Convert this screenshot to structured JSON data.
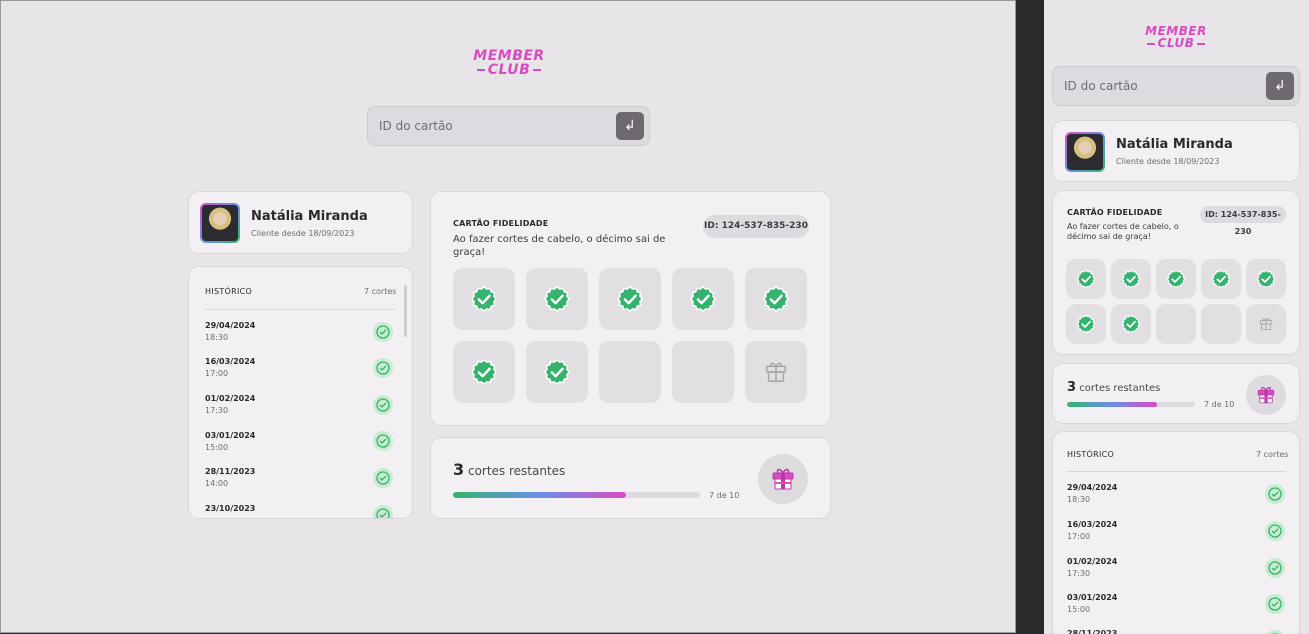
{
  "app": {
    "logo_line1": "MEMBER",
    "logo_line2": "CLUB"
  },
  "search": {
    "placeholder": "ID do cartão",
    "submit_icon": "enter-icon"
  },
  "user": {
    "name": "Natália Miranda",
    "since": "Cliente desde 18/09/2023"
  },
  "history": {
    "title": "HISTÓRICO",
    "count": "7 cortes",
    "items": [
      {
        "date": "29/04/2024",
        "time": "18:30"
      },
      {
        "date": "16/03/2024",
        "time": "17:00"
      },
      {
        "date": "01/02/2024",
        "time": "17:30"
      },
      {
        "date": "03/01/2024",
        "time": "15:00"
      },
      {
        "date": "28/11/2023",
        "time": "14:00"
      },
      {
        "date": "23/10/2023",
        "time": ""
      }
    ]
  },
  "loyalty": {
    "label": "CARTÃO FIDELIDADE",
    "description": "Ao fazer cortes de cabelo, o décimo sai de graça!",
    "id_badge": "ID: 124-537-835-230",
    "total_slots": 10,
    "completed": 7
  },
  "progress": {
    "remaining_number": "3",
    "remaining_text": "cortes restantes",
    "count_text": "7 de 10",
    "fraction": 0.7
  },
  "colors": {
    "accent": "#d94bc3",
    "check": "#35b26e",
    "background": "#e7e5e8"
  }
}
